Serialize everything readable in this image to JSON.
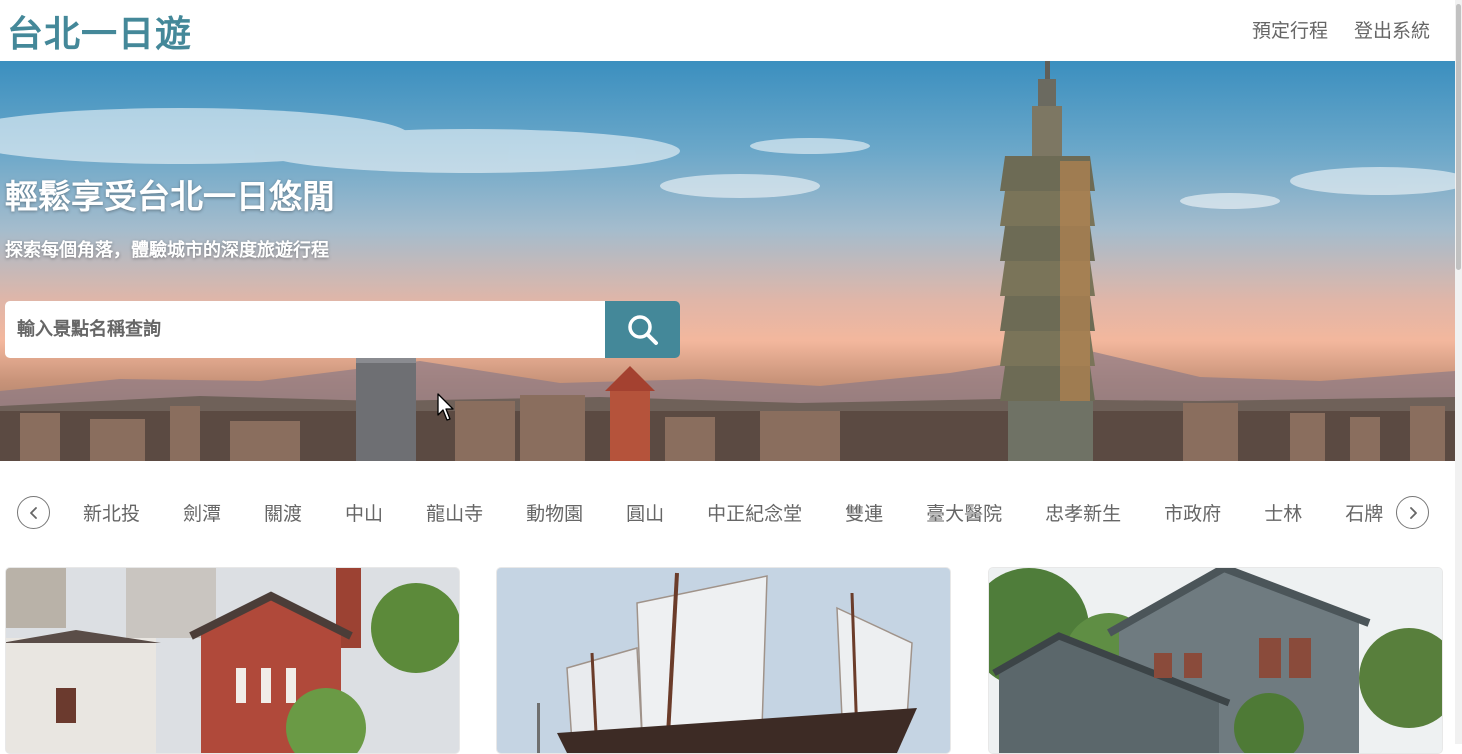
{
  "header": {
    "brand": "台北一日遊",
    "nav": [
      {
        "label": "預定行程"
      },
      {
        "label": "登出系統"
      }
    ]
  },
  "hero": {
    "title": "輕鬆享受台北一日悠閒",
    "subtitle": "探索每個角落，體驗城市的深度旅遊行程",
    "search": {
      "placeholder": "輸入景點名稱查詢",
      "value": "",
      "icon": "search-icon"
    }
  },
  "mrt_list": {
    "left_icon": "chevron-left-icon",
    "right_icon": "chevron-right-icon",
    "items": [
      "新北投",
      "劍潭",
      "關渡",
      "中山",
      "龍山寺",
      "動物園",
      "圓山",
      "中正紀念堂",
      "雙連",
      "臺大醫院",
      "忠孝新生",
      "市政府",
      "士林",
      "石牌"
    ]
  },
  "colors": {
    "brand": "#448899",
    "nav_text": "#666666",
    "hero_text": "#ffffff"
  }
}
